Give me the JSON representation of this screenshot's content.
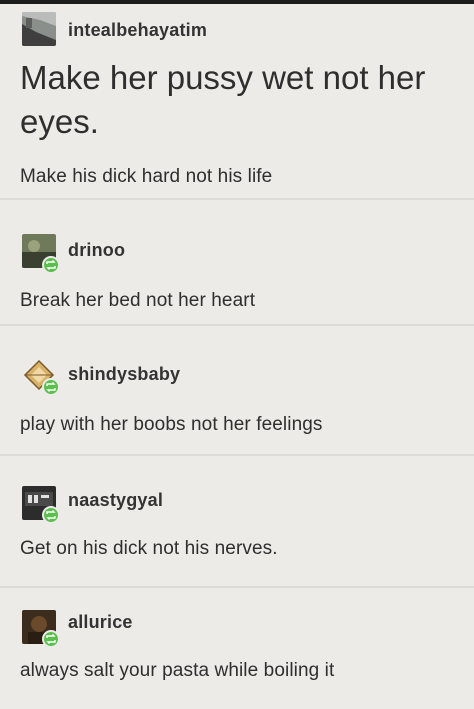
{
  "posts": [
    {
      "username": "intealbehayatim",
      "title": "Make her pussy wet not her eyes.",
      "body": "Make his dick hard not his life",
      "avatar_icon": "landscape-avatar-icon"
    },
    {
      "username": "drinoo",
      "body": "Break her bed not her heart",
      "avatar_icon": "photo-avatar-icon",
      "badge_icon": "reblog-icon"
    },
    {
      "username": "shindysbaby",
      "body": "play with her boobs not her feelings",
      "avatar_icon": "diamond-avatar-icon",
      "badge_icon": "reblog-icon"
    },
    {
      "username": "naastygyal",
      "body": "Get on his dick not his nerves.",
      "avatar_icon": "text-avatar-icon",
      "badge_icon": "reblog-icon"
    },
    {
      "username": "allurice",
      "body": "always salt your pasta while boiling it",
      "avatar_icon": "photo-avatar-icon",
      "badge_icon": "reblog-icon"
    }
  ],
  "colors": {
    "background": "#ecebe8",
    "text": "#2e2e2e",
    "reblog_badge": "#5bbf4e",
    "divider": "#dcdbd7"
  }
}
